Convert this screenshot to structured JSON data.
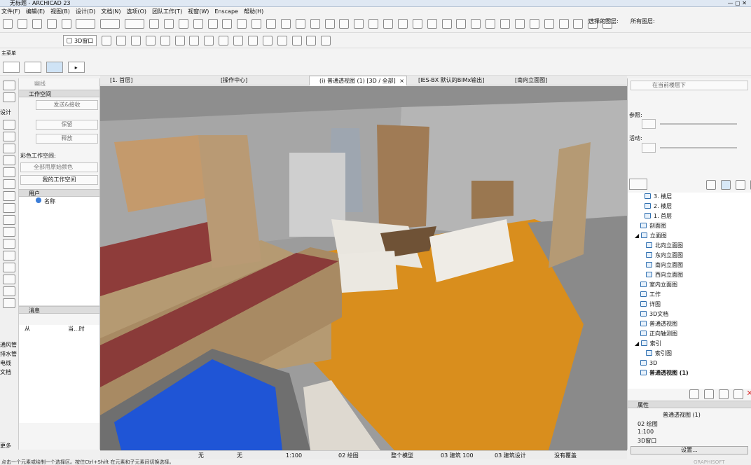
{
  "window": {
    "title": "无标题 - ARCHICAD 23"
  },
  "menu": [
    "文件(F)",
    "编辑(E)",
    "视图(B)",
    "设计(D)",
    "文档(N)",
    "选项(O)",
    "团队工作(T)",
    "视窗(W)",
    "Enscape",
    "帮助(H)"
  ],
  "toolbar": {
    "selected_items_label": "选择的图层:",
    "all_items_label": "所有图层:",
    "view3d_label": "3D窗口",
    "home_label": "主菜单"
  },
  "tabs": [
    {
      "label": "[1. 首层]"
    },
    {
      "label": "[操作中心]"
    },
    {
      "label": "(i) 普通透视图 (1) [3D / 全部]"
    },
    {
      "label": "[IES-BX 默认的BIMx输出]"
    },
    {
      "label": "[南向立面图]"
    }
  ],
  "left_panel": {
    "ghost_label": "幽线",
    "workspace_title": "工作空间",
    "send_receive": "发送&接收",
    "reserve": "保留",
    "release": "释放",
    "color_workspace": "彩色工作空间:",
    "all_color": "全部用原始颜色",
    "my_workspace": "我的工作空间",
    "users_title": "用户",
    "name_label": "名称",
    "messages_title": "消息",
    "from_label": "从",
    "time_label": "当...时"
  },
  "left_strip_labels": [
    "设计",
    "通风管",
    "排水管",
    "电线",
    "文档",
    "更多"
  ],
  "right_panel": {
    "layer_placeholder": "在当前楼层下",
    "ref_label": "参照:",
    "active_label": "活动:",
    "tree": [
      {
        "label": "3. 楼层",
        "level": 2
      },
      {
        "label": "2. 楼层",
        "level": 2
      },
      {
        "label": "1. 首层",
        "level": 2
      },
      {
        "label": "剖面图",
        "level": 1
      },
      {
        "label": "立面图",
        "level": 1
      },
      {
        "label": "北向立面图",
        "level": 2
      },
      {
        "label": "东向立面图",
        "level": 2
      },
      {
        "label": "南向立面图",
        "level": 2
      },
      {
        "label": "西向立面图",
        "level": 2
      },
      {
        "label": "室内立面图",
        "level": 1
      },
      {
        "label": "工作",
        "level": 1
      },
      {
        "label": "详图",
        "level": 1
      },
      {
        "label": "3D文档",
        "level": 1
      },
      {
        "label": "普通透视图",
        "level": 1
      },
      {
        "label": "正向轴测图",
        "level": 1
      },
      {
        "label": "索引",
        "level": 1
      },
      {
        "label": "索引图",
        "level": 2
      },
      {
        "label": "3D",
        "level": 1
      },
      {
        "label": "普通透视图 (1)",
        "level": 1
      }
    ],
    "props_title": "属性",
    "prop_view": "普通透视图 (1)",
    "prop_layer": "02 绘图",
    "prop_scale": "1:100",
    "prop_window": "3D窗口",
    "settings_button": "设置..."
  },
  "statusbar": {
    "zoom_none1": "无",
    "zoom_none2": "无",
    "scale": "1:100",
    "layer": "02 绘图",
    "model": "整个模型",
    "design": "03 建筑 100",
    "design2": "03 建筑设计",
    "override": "没有覆盖"
  },
  "hint": "点击一个元素或绘制一个选择区。按住Ctrl+Shift 在元素和子元素间切换选择。",
  "logo": "GRAPHISOFT"
}
